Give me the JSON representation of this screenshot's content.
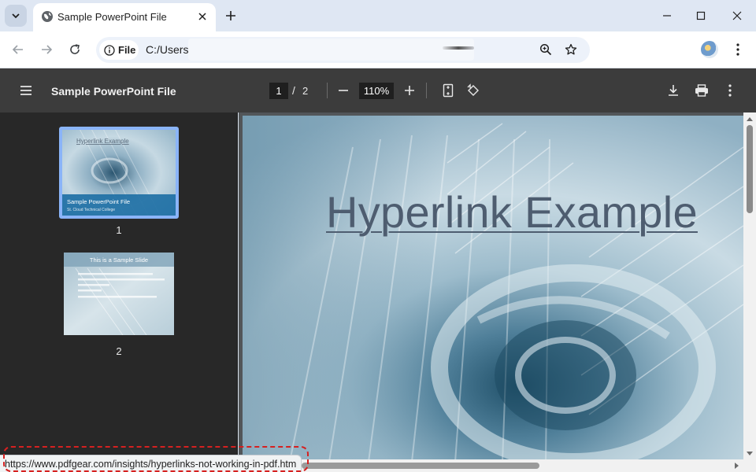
{
  "browser": {
    "tab": {
      "title": "Sample PowerPoint File",
      "favicon": "globe-icon"
    },
    "omnibox": {
      "scheme_chip": "File",
      "url": "C:/Users/"
    }
  },
  "pdf_viewer": {
    "title": "Sample PowerPoint File",
    "current_page": "1",
    "separator": "/",
    "total_pages": "2",
    "zoom": "110%"
  },
  "thumbnails": [
    {
      "label": "1",
      "selected": true
    },
    {
      "label": "2",
      "selected": false
    }
  ],
  "thumbnail_texts": {
    "slide1_title": "Hyperlink Example",
    "slide1_footer": "Sample PowerPoint File",
    "slide1_sub": "St. Cloud Technical College",
    "slide2_title": "This is a Sample Slide"
  },
  "page": {
    "slide_title": "Hyperlink Example"
  },
  "status_bar": {
    "link_url": "https://www.pdfgear.com/insights/hyperlinks-not-working-in-pdf.htm"
  },
  "colors": {
    "accent": "#8ab4f8",
    "pdf_toolbar": "#3c3c3c",
    "sidebar": "#282828",
    "annotation": "#d62020"
  }
}
